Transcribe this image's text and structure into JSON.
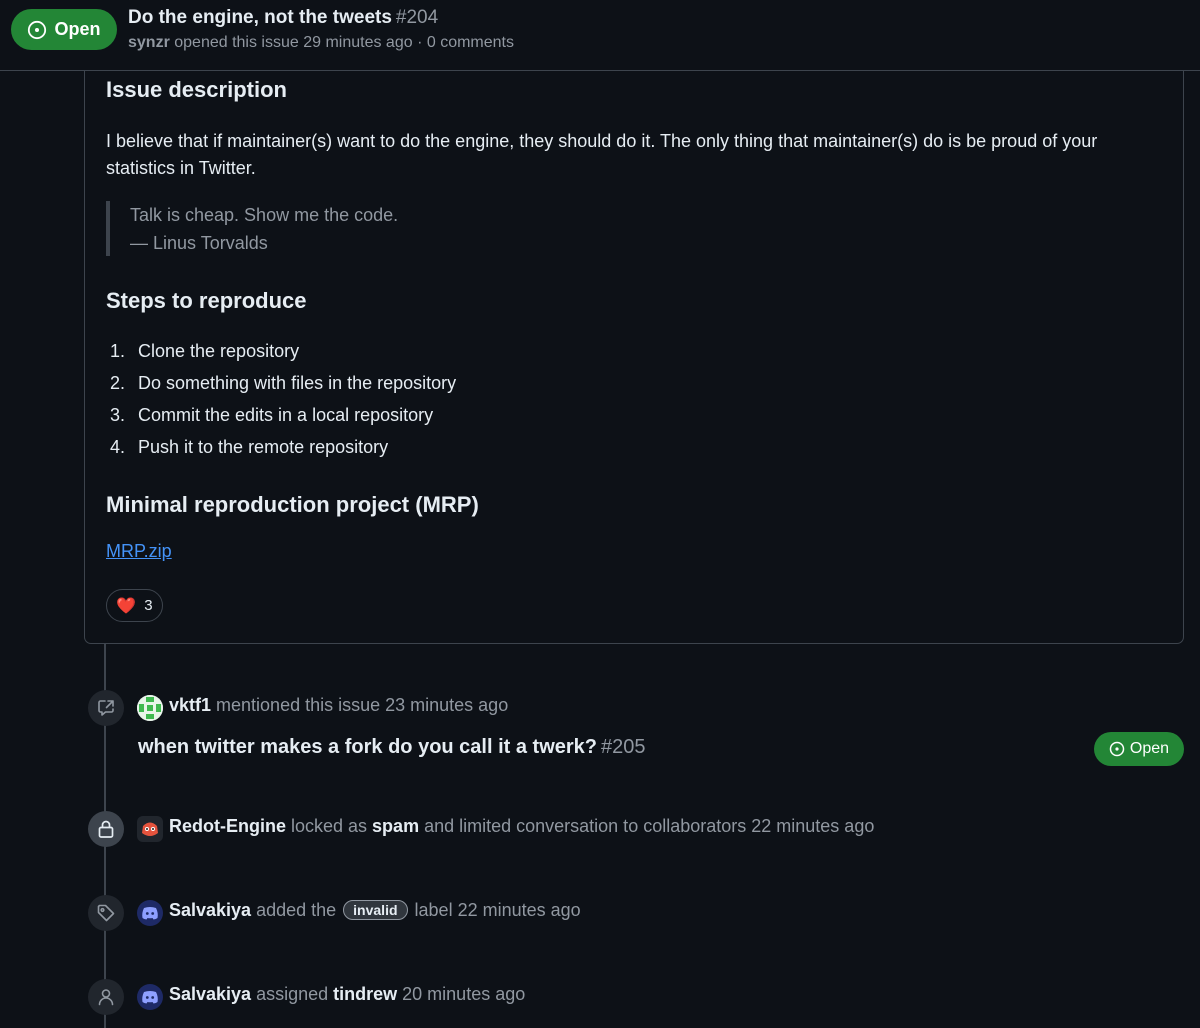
{
  "header": {
    "state": "Open",
    "title": "Do the engine, not the tweets",
    "number": "#204",
    "author": "synzr",
    "meta": " opened this issue 29 minutes ago · 0 comments"
  },
  "body": {
    "heading_description": "Issue description",
    "paragraph": "I believe that if maintainer(s) want to do the engine, they should do it. The only thing that maintainer(s) do is be proud of your statistics in Twitter.",
    "quote_line1": "Talk is cheap. Show me the code.",
    "quote_line2": "— Linus Torvalds",
    "heading_steps": "Steps to reproduce",
    "steps": [
      {
        "n": "1.",
        "text": "Clone the repository"
      },
      {
        "n": "2.",
        "text": "Do something with files in the repository"
      },
      {
        "n": "3.",
        "text": "Commit the edits in a local repository"
      },
      {
        "n": "4.",
        "text": "Push it to the remote repository"
      }
    ],
    "heading_mrp": "Minimal reproduction project (MRP)",
    "mrp_link": "MRP.zip",
    "reaction_emoji": "❤️",
    "reaction_count": "3"
  },
  "timeline": {
    "mention": {
      "user": "vktf1",
      "action": " mentioned this issue 23 minutes ago",
      "ref_title": "when twitter makes a fork do you call it a twerk?",
      "ref_number": "#205",
      "ref_state": "Open"
    },
    "lock": {
      "user": "Redot-Engine",
      "action1": " locked as ",
      "reason": "spam",
      "action2": " and limited conversation to collaborators 22 minutes ago"
    },
    "label": {
      "user": "Salvakiya",
      "action1": " added the ",
      "label_name": "invalid",
      "action2": " label 22 minutes ago"
    },
    "assign": {
      "user": "Salvakiya",
      "action1": " assigned ",
      "assignee": "tindrew",
      "action2": " 20 minutes ago"
    }
  },
  "icons": {
    "issue_open": "issue-opened-icon",
    "cross_ref": "cross-reference-icon",
    "lock": "lock-icon",
    "tag": "tag-icon",
    "person": "person-icon"
  },
  "colors": {
    "open_green": "#238636",
    "link_blue": "#4493f8",
    "background": "#0d1117",
    "muted": "#9198a1"
  }
}
